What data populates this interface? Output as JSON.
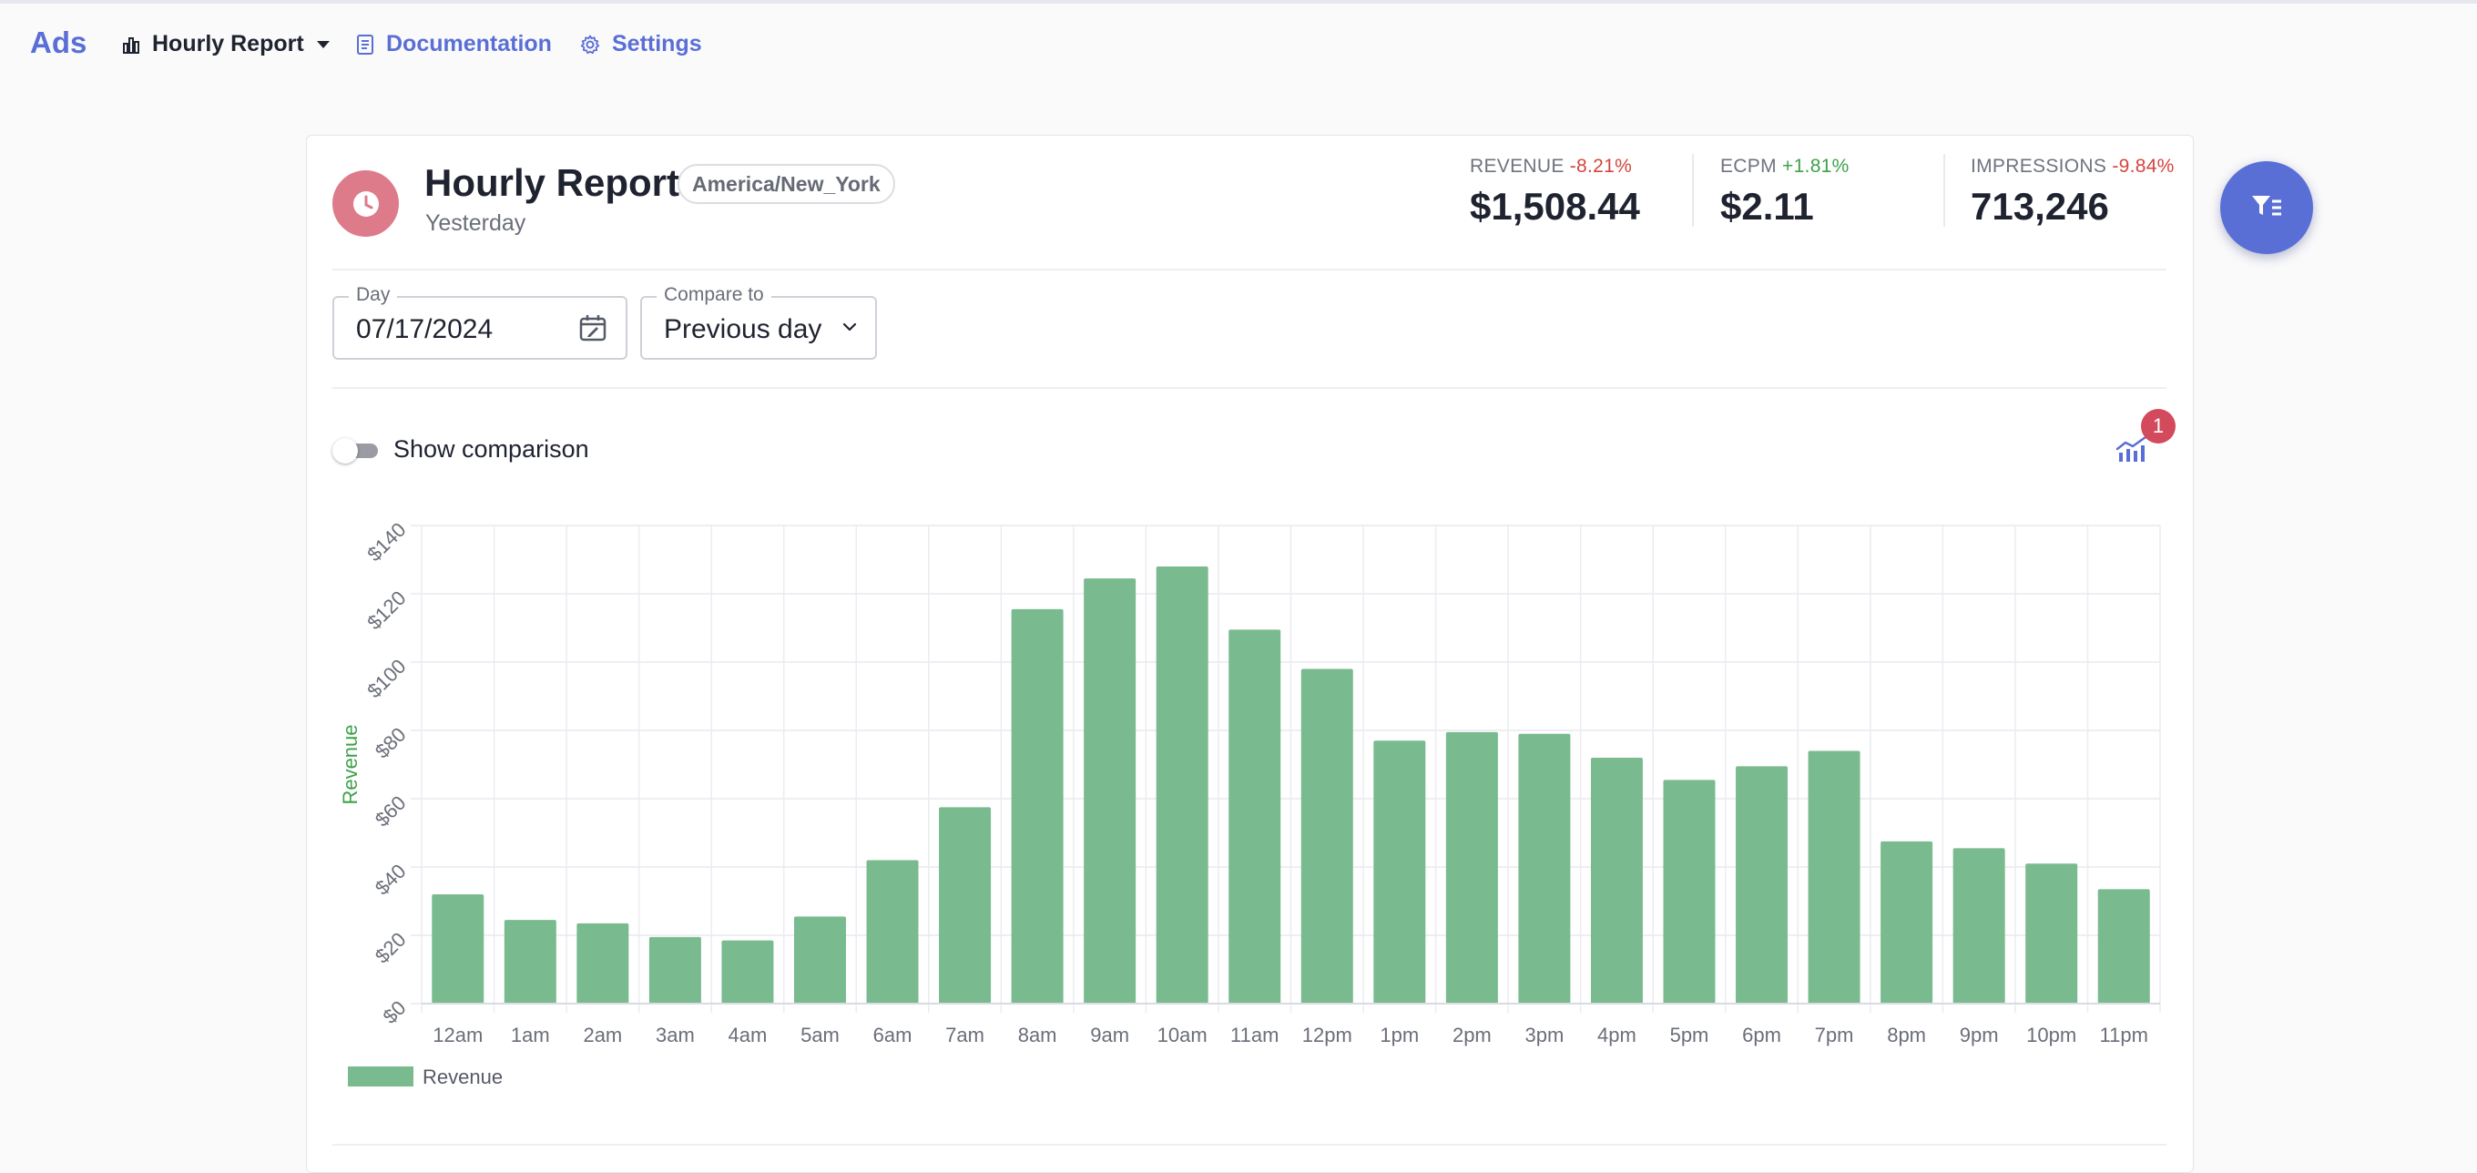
{
  "nav": {
    "brand": "Ads",
    "hourly_report": "Hourly Report",
    "documentation": "Documentation",
    "settings": "Settings"
  },
  "report": {
    "title": "Hourly Report",
    "timezone": "America/New_York",
    "subtitle": "Yesterday"
  },
  "metrics": {
    "revenue": {
      "label": "REVENUE",
      "change": "-8.21%",
      "value": "$1,508.44"
    },
    "ecpm": {
      "label": "ECPM",
      "change": "+1.81%",
      "value": "$2.11"
    },
    "impressions": {
      "label": "IMPRESSIONS",
      "change": "-9.84%",
      "value": "713,246"
    }
  },
  "filters": {
    "day_label": "Day",
    "day_value": "07/17/2024",
    "compare_label": "Compare to",
    "compare_value": "Previous day"
  },
  "comparison": {
    "label": "Show comparison",
    "enabled": false,
    "badge_count": "1"
  },
  "colors": {
    "accent": "#5a6fd6",
    "bar": "#79bb8f",
    "negative": "#d6443d",
    "positive": "#3ea14a"
  },
  "chart_data": {
    "type": "bar",
    "categories": [
      "12am",
      "1am",
      "2am",
      "3am",
      "4am",
      "5am",
      "6am",
      "7am",
      "8am",
      "9am",
      "10am",
      "11am",
      "12pm",
      "1pm",
      "2pm",
      "3pm",
      "4pm",
      "5pm",
      "6pm",
      "7pm",
      "8pm",
      "9pm",
      "10pm",
      "11pm"
    ],
    "series": [
      {
        "name": "Revenue",
        "values": [
          32,
          24.5,
          23.5,
          19.5,
          18.5,
          25.5,
          42,
          57.5,
          115.5,
          124.5,
          128,
          109.5,
          98,
          77,
          79.5,
          79,
          72,
          65.5,
          69.5,
          74,
          47.5,
          45.5,
          41,
          33.5
        ]
      }
    ],
    "ylabel": "Revenue",
    "ylim": [
      0,
      140
    ],
    "yticks": [
      "$0",
      "$20",
      "$40",
      "$60",
      "$80",
      "$100",
      "$120",
      "$140"
    ],
    "grid": true,
    "legend": "bottom-left"
  }
}
